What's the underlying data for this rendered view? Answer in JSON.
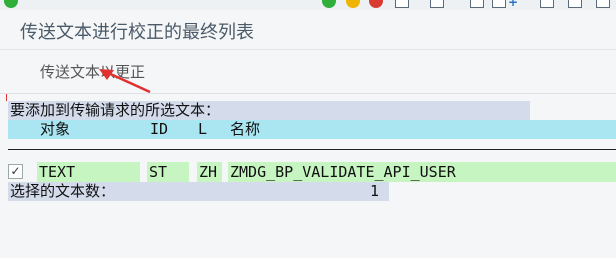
{
  "screen": {
    "title": "传送文本进行校正的最终列表",
    "sub_button_label": "传送文本以更正",
    "header_text": "要添加到传输请求的所选文本：",
    "columns": {
      "object": "对象",
      "id": "ID",
      "l": "L",
      "name": "名称"
    },
    "rows": [
      {
        "checked": true,
        "object": "TEXT",
        "id": "ST",
        "l": "ZH",
        "name": "ZMDG_BP_VALIDATE_API_USER"
      }
    ],
    "summary_label": "选择的文本数：",
    "summary_count": "1"
  },
  "colors": {
    "header_bg": "#d4dcec",
    "column_header_bg": "#a9e6f2",
    "row_bg": "#c6f5c2",
    "arrow": "#e03030"
  }
}
